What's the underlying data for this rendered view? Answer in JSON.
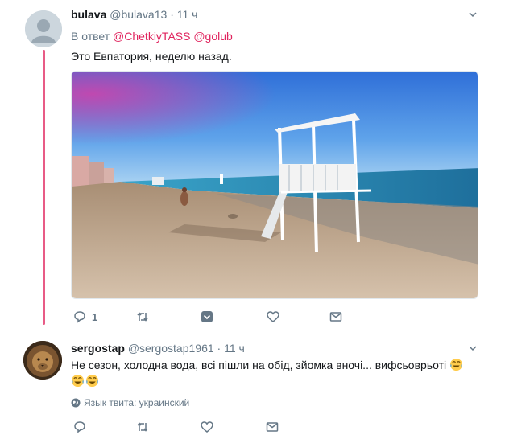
{
  "tweet1": {
    "name": "bulava",
    "handle": "@bulava13",
    "dot": "·",
    "time": "11 ч",
    "reply_prefix": "В ответ",
    "reply_mention1": "@ChetkiyTASS",
    "reply_mention2": "@golub",
    "text": "Это Евпатория, неделю назад.",
    "reply_count": "1",
    "icons": [
      "reply-icon",
      "retweet-icon",
      "like-icon",
      "direct-message-icon"
    ]
  },
  "tweet2": {
    "name": "sergostap",
    "handle": "@sergostap1961",
    "dot": "·",
    "time": "11 ч",
    "text": "Не сезон, холодна вода, всі пішли на обід, зйомка вночі... вифсьоврьоті",
    "language": "Язык твита: украинский",
    "icons": [
      "reply-icon",
      "retweet-icon",
      "like-icon",
      "direct-message-icon"
    ]
  },
  "colors": {
    "accent": "#e0245e",
    "muted": "#657786",
    "text": "#14171a"
  }
}
